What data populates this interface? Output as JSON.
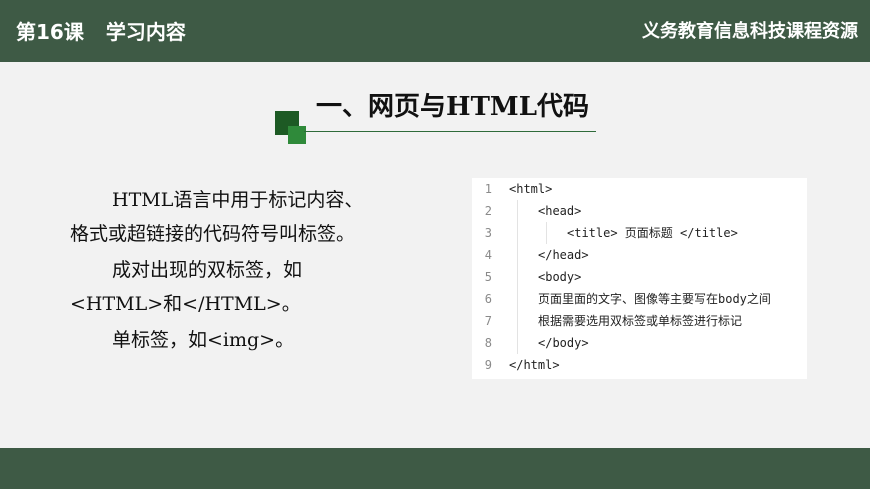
{
  "header": {
    "lesson": "第16课",
    "section": "学习内容",
    "resource": "义务教育信息科技课程资源"
  },
  "title": {
    "text": "一、网页与HTML代码"
  },
  "content": {
    "paragraphs": [
      [
        "HTML语言中用于标记内容、",
        "格式或超链接的代码符号叫标签。"
      ],
      [
        "成对出现的双标签，如",
        "<HTML>和</HTML>。"
      ],
      [
        "单标签，如<img>。"
      ]
    ]
  },
  "code": {
    "lines": [
      {
        "num": "1",
        "text": "<html>"
      },
      {
        "num": "2",
        "text": "<head>"
      },
      {
        "num": "3",
        "text": "<title> 页面标题 </title>"
      },
      {
        "num": "4",
        "text": "</head>"
      },
      {
        "num": "5",
        "text": "<body>"
      },
      {
        "num": "6",
        "text": "页面里面的文字、图像等主要写在body之间"
      },
      {
        "num": "7",
        "text": "根据需要选用双标签或单标签进行标记"
      },
      {
        "num": "8",
        "text": "</body>"
      },
      {
        "num": "9",
        "text": "</html>"
      }
    ]
  }
}
